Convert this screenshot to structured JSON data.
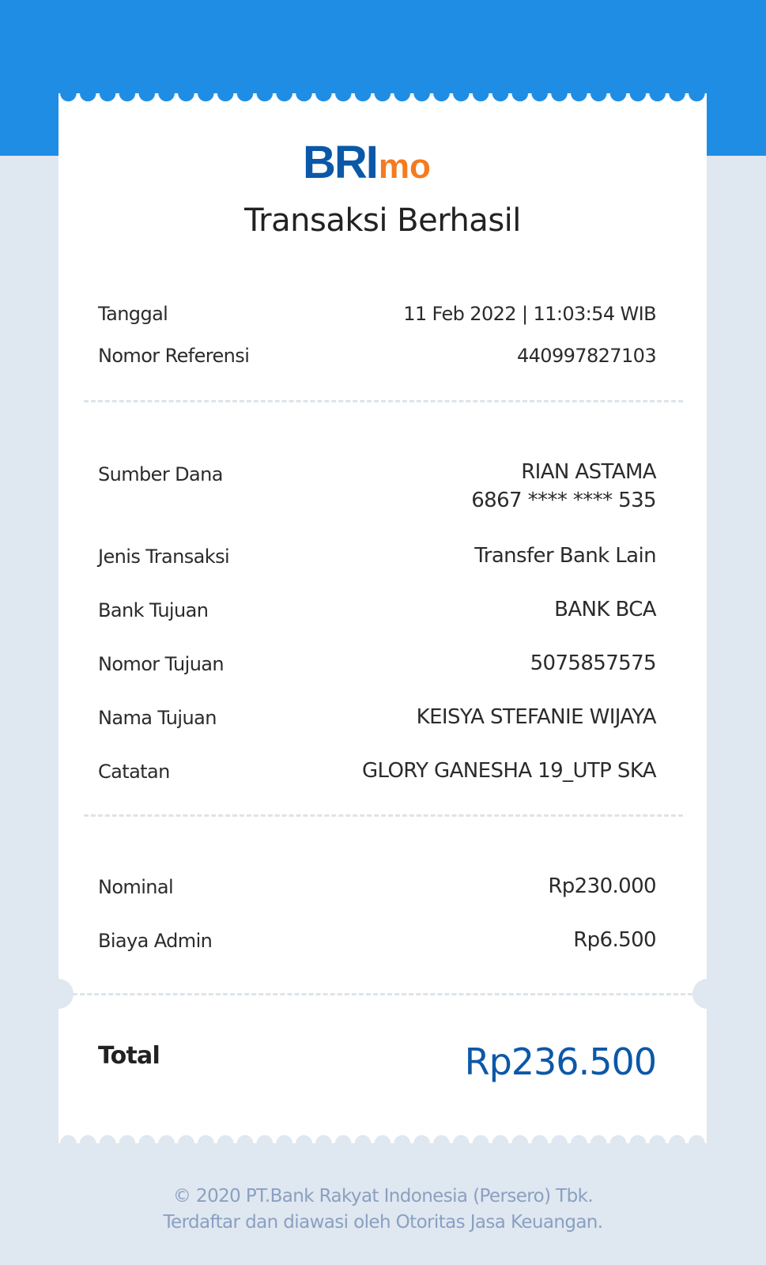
{
  "brand": {
    "logo_primary": "BRI",
    "logo_secondary": "mo",
    "primary_color": "#0b58a8",
    "accent_color": "#f47b20"
  },
  "header": {
    "title": "Transaksi Berhasil"
  },
  "meta": [
    {
      "label": "Tanggal",
      "value": "11 Feb 2022 | 11:03:54 WIB"
    },
    {
      "label": "Nomor Referensi",
      "value": "440997827103"
    }
  ],
  "details": {
    "source": {
      "label": "Sumber Dana",
      "name": "RIAN ASTAMA",
      "account": "6867 **** **** 535"
    },
    "items": [
      {
        "label": "Jenis Transaksi",
        "value": "Transfer Bank Lain"
      },
      {
        "label": "Bank Tujuan",
        "value": "BANK BCA"
      },
      {
        "label": "Nomor Tujuan",
        "value": "5075857575"
      },
      {
        "label": "Nama Tujuan",
        "value": "KEISYA STEFANIE WIJAYA"
      },
      {
        "label": "Catatan",
        "value": "GLORY GANESHA 19_UTP SKA"
      }
    ]
  },
  "amounts": [
    {
      "label": "Nominal",
      "value": "Rp230.000"
    },
    {
      "label": "Biaya Admin",
      "value": "Rp6.500"
    }
  ],
  "total": {
    "label": "Total",
    "value": "Rp236.500"
  },
  "footer": {
    "line1": "© 2020 PT.Bank Rakyat Indonesia (Persero) Tbk.",
    "line2": "Terdaftar dan diawasi oleh Otoritas Jasa Keuangan."
  }
}
